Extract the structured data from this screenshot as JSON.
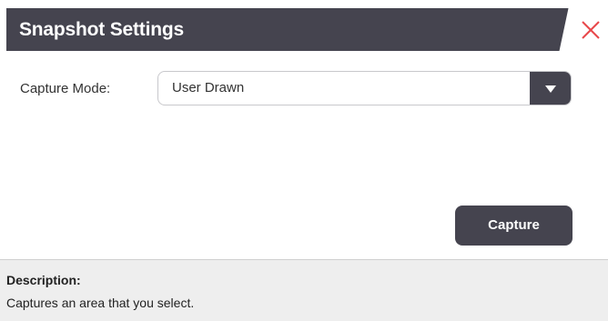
{
  "dialog": {
    "title": "Snapshot Settings",
    "close_icon": "close-x-icon",
    "close_color": "#e8474a",
    "titlebar_color": "#45444f"
  },
  "capture_mode": {
    "label": "Capture Mode:",
    "selected": "User Drawn",
    "arrow_icon": "triangle-down-icon"
  },
  "actions": {
    "capture_label": "Capture"
  },
  "description": {
    "title": "Description:",
    "text": "Captures an area that you select."
  }
}
